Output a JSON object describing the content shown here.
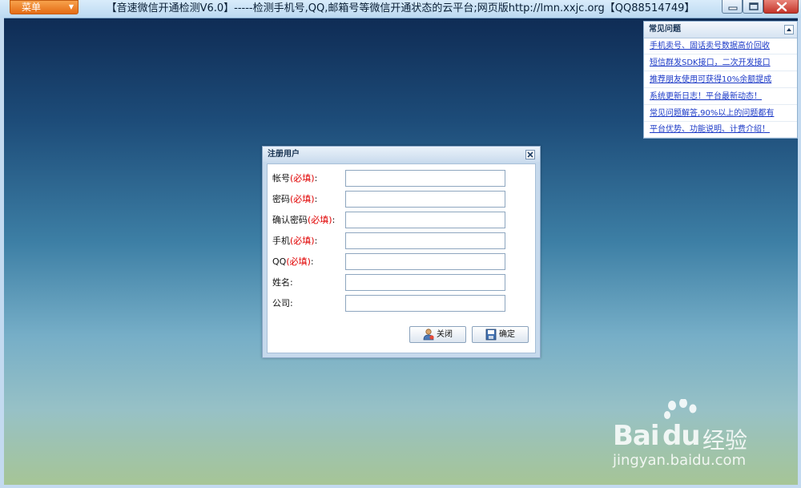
{
  "titlebar": {
    "menu_label": "菜单",
    "title": "【音速微信开通检测V6.0】-----检测手机号,QQ,邮箱号等微信开通状态的云平台;网页版http://lmn.xxjc.org【QQ88514749】"
  },
  "faq": {
    "title": "常见问题",
    "items": [
      "手机卖号、固话卖号数据高价回收",
      "短信群发SDK接口，二次开发接口",
      "推荐朋友使用可获得10%余额提成",
      "系统更新日志！平台最新动态！",
      "常见问题解答,90%以上的问题都有",
      "平台优势、功能说明、计费介绍！"
    ]
  },
  "dialog": {
    "title": "注册用户",
    "fields": [
      {
        "label": "帐号",
        "required": "(必填)",
        "colon": ":",
        "value": ""
      },
      {
        "label": "密码",
        "required": "(必填)",
        "colon": ":",
        "value": ""
      },
      {
        "label": "确认密码",
        "required": "(必填)",
        "colon": ":",
        "value": ""
      },
      {
        "label": "手机",
        "required": "(必填)",
        "colon": ":",
        "value": ""
      },
      {
        "label": "QQ",
        "required": "(必填)",
        "colon": ":",
        "value": ""
      },
      {
        "label": "姓名",
        "required": "",
        "colon": ":",
        "value": ""
      },
      {
        "label": "公司",
        "required": "",
        "colon": ":",
        "value": ""
      }
    ],
    "close_label": "关闭",
    "ok_label": "确定"
  },
  "watermark": {
    "brand": "Bai",
    "brand_du": "du",
    "brand_cn": "经验",
    "url": "jingyan.baidu.com"
  },
  "colors": {
    "accent_orange": "#e46b14",
    "link_blue": "#1b39c7",
    "required_red": "#e00000"
  }
}
